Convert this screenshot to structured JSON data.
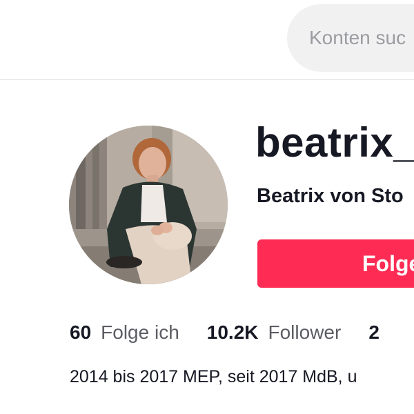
{
  "search": {
    "placeholder": "Konten suc"
  },
  "profile": {
    "username": "beatrix_",
    "display_name": "Beatrix von Sto",
    "follow_label": "Folge",
    "bio": "2014 bis 2017 MEP, seit 2017 MdB, u"
  },
  "stats": [
    {
      "value": "60",
      "label": "Folge ich"
    },
    {
      "value": "10.2K",
      "label": "Follower"
    },
    {
      "value": "2",
      "label": ""
    }
  ],
  "colors": {
    "accent": "#fe2c55",
    "text_primary": "#161823",
    "text_secondary": "#5c5d64",
    "search_bg": "#f1f1f2"
  },
  "icons": {
    "avatar": "profile-photo"
  }
}
